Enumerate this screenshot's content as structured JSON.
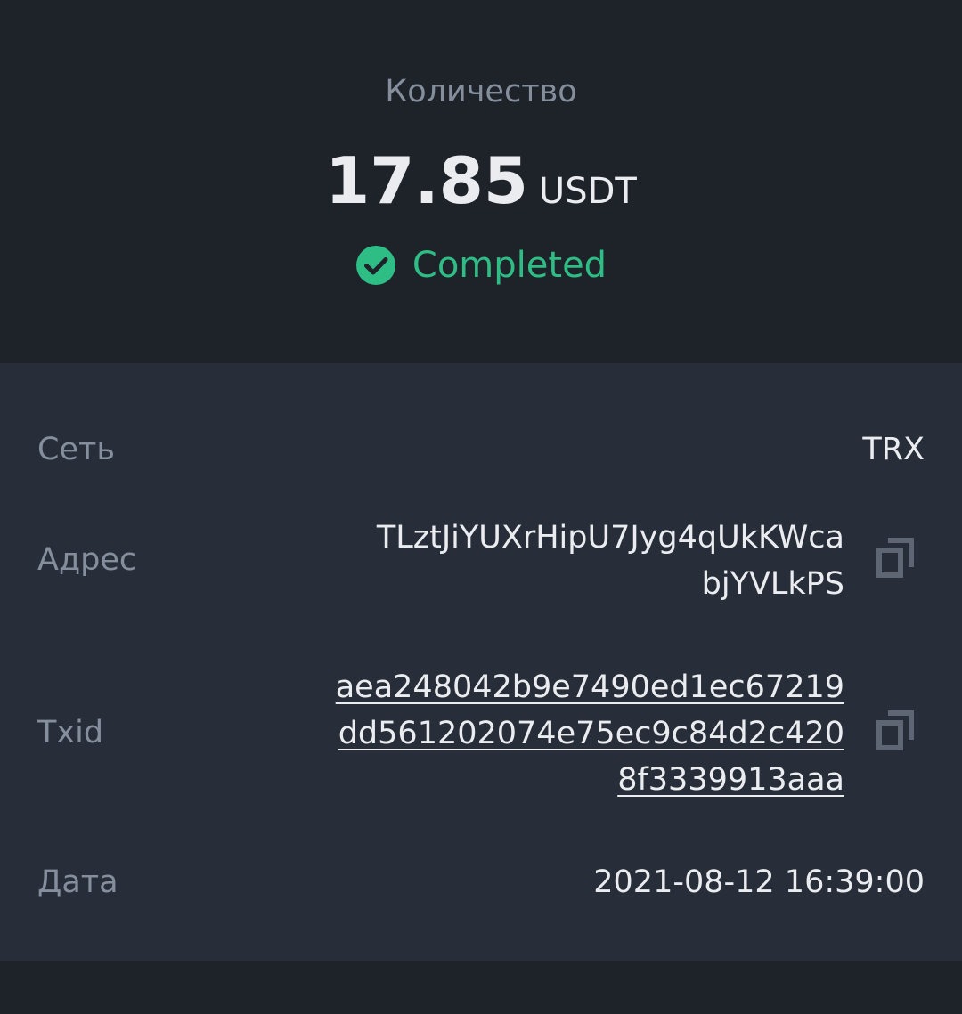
{
  "header": {
    "quantity_label": "Количество",
    "amount": "17.85",
    "currency": "USDT",
    "status": "Completed",
    "status_color": "#2ebd85"
  },
  "details": {
    "network": {
      "label": "Сеть",
      "value": "TRX"
    },
    "address": {
      "label": "Адрес",
      "lines": [
        "TLztJiYUXrHipU7Jyg4qUkKWca",
        "bjYVLkPS"
      ],
      "icon": "copy-icon"
    },
    "txid": {
      "label": "Txid",
      "lines": [
        "aea248042b9e7490ed1ec67219",
        "dd561202074e75ec9c84d2c420",
        "8f3339913aaa"
      ],
      "icon": "copy-icon"
    },
    "date": {
      "label": "Дата",
      "value": "2021-08-12 16:39:00"
    }
  },
  "colors": {
    "background": "#1e2329",
    "panel": "#272e39",
    "text_primary": "#eaecef",
    "text_secondary": "#848e9c",
    "success": "#2ebd85"
  }
}
